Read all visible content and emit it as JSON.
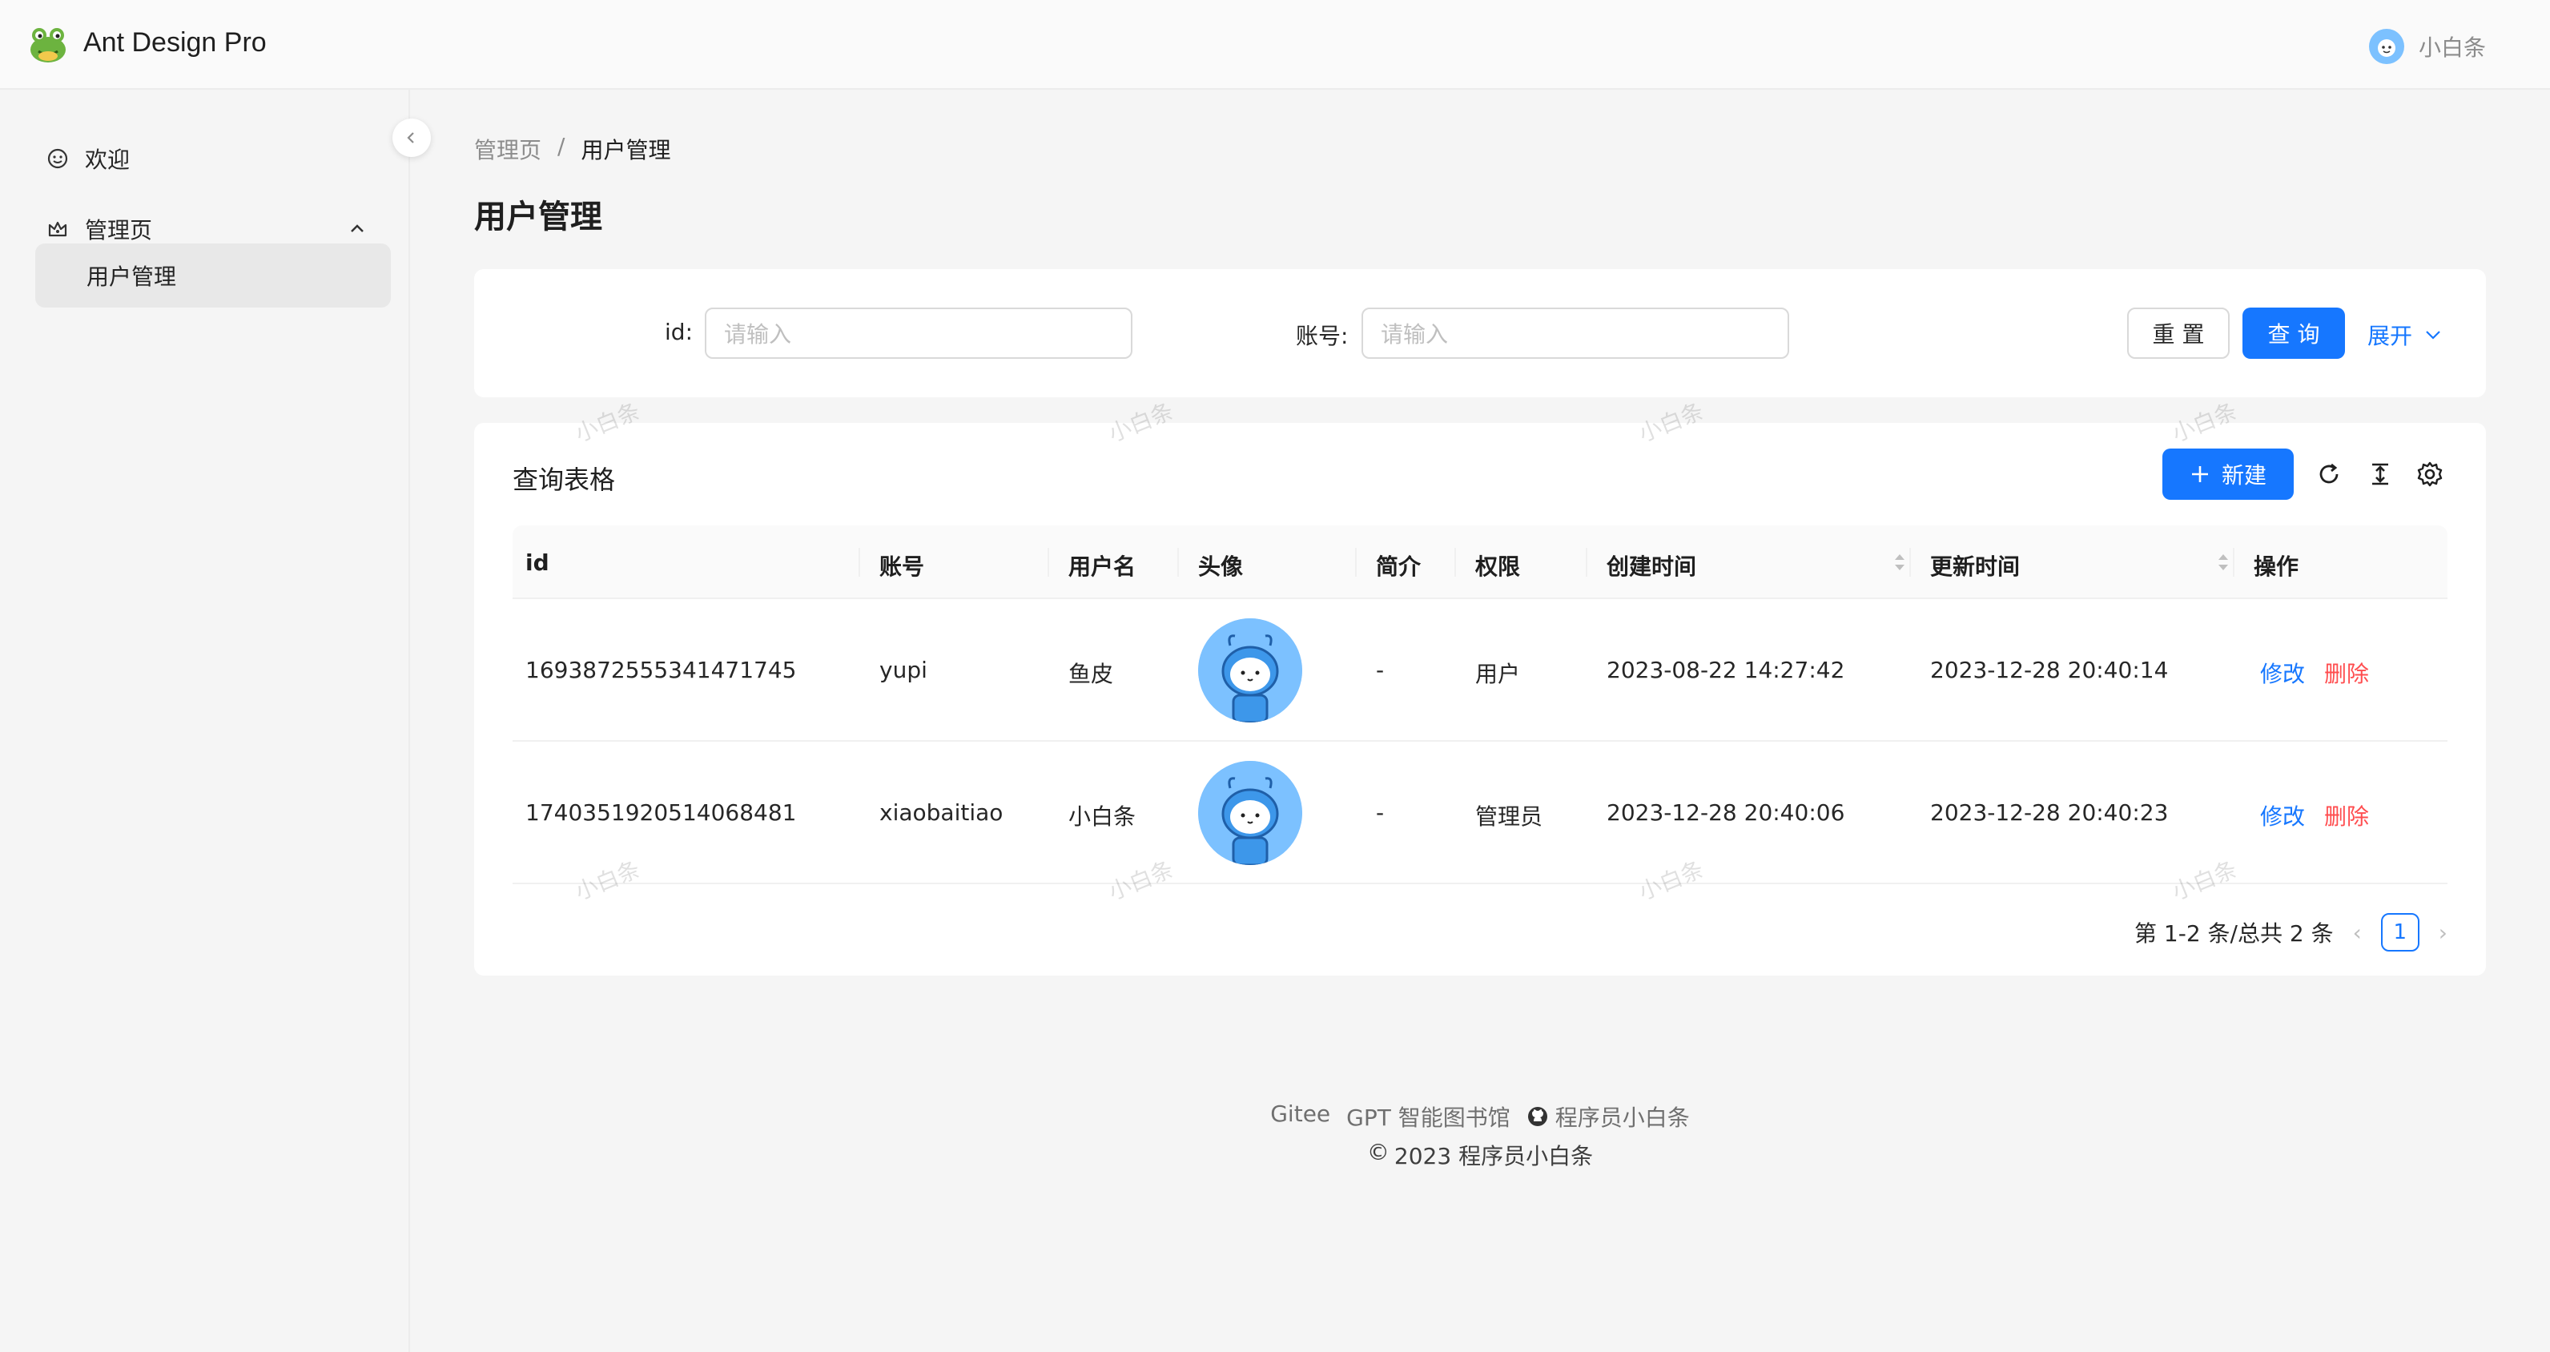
{
  "header": {
    "app_title": "Ant Design Pro",
    "logo_icon": "frog-logo-icon",
    "user_name": "小白条"
  },
  "sidebar": {
    "items": [
      {
        "label": "欢迎",
        "icon": "smile-icon"
      },
      {
        "label": "管理页",
        "icon": "crown-icon",
        "expanded": true
      },
      {
        "label": "用户管理",
        "selected": true
      }
    ]
  },
  "breadcrumb": {
    "items": [
      "管理页",
      "用户管理"
    ],
    "separator": "/"
  },
  "page_title": "用户管理",
  "search": {
    "id_label": "id",
    "id_placeholder": "请输入",
    "account_label": "账号",
    "account_placeholder": "请输入",
    "reset_label": "重 置",
    "query_label": "查 询",
    "expand_label": "展开"
  },
  "table": {
    "title": "查询表格",
    "new_label": "新建",
    "toolbar_icons": [
      "reload-icon",
      "column-height-icon",
      "settings-icon"
    ],
    "columns": [
      "id",
      "账号",
      "用户名",
      "头像",
      "简介",
      "权限",
      "创建时间",
      "更新时间",
      "操作"
    ],
    "rows": [
      {
        "id": "1693872555341471745",
        "account": "yupi",
        "username": "鱼皮",
        "bio": "-",
        "role": "用户",
        "created": "2023-08-22 14:27:42",
        "updated": "2023-12-28 20:40:14",
        "edit": "修改",
        "delete": "删除"
      },
      {
        "id": "1740351920514068481",
        "account": "xiaobaitiao",
        "username": "小白条",
        "bio": "-",
        "role": "管理员",
        "created": "2023-12-28 20:40:06",
        "updated": "2023-12-28 20:40:23",
        "edit": "修改",
        "delete": "删除"
      }
    ],
    "pagination": {
      "summary": "第 1-2 条/总共 2 条",
      "current_page": "1"
    }
  },
  "watermark_text": "小白条",
  "footer": {
    "links": [
      "Gitee",
      "GPT 智能图书馆",
      "程序员小白条"
    ],
    "copyright_symbol": "©",
    "copyright": "2023 程序员小白条"
  },
  "colors": {
    "primary": "#1677ff",
    "danger": "#ff4d4f"
  }
}
